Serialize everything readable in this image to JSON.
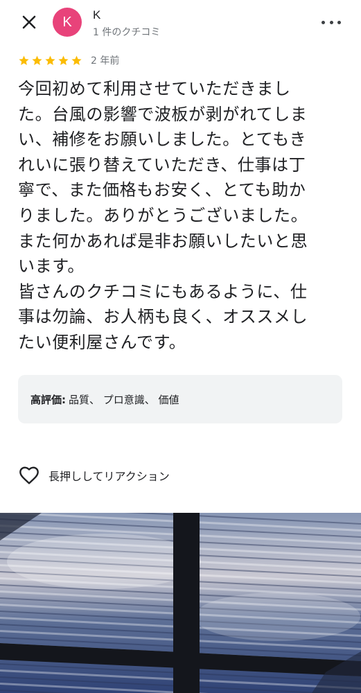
{
  "header": {
    "avatar_initial": "K",
    "author_name": "K",
    "author_meta": "1 件のクチコミ",
    "avatar_color": "#e8437a"
  },
  "rating": {
    "stars": 5,
    "max_stars": 5,
    "date": "2 年前",
    "star_color": "#fbbc04"
  },
  "review": {
    "lines": [
      "今回初めて利用させていただきまし",
      "た。台風の影響で波板が剥がれてしま",
      "い、補修をお願いしました。とてもき",
      "れいに張り替えていただき、仕事は丁",
      "寧で、また価格もお安く、とても助か",
      "りました。ありがとうございました。",
      "また何かあれば是非お願いしたいと思",
      "います。",
      "皆さんのクチコミにもあるように、仕",
      "事は勿論、お人柄も良く、オススメし",
      "たい便利屋さんです。"
    ]
  },
  "highlights": {
    "label": "高評価:",
    "items": "品質、 プロ意識、 価値"
  },
  "reaction": {
    "label": "長押ししてリアクション"
  },
  "photo": {
    "icon": "corrugated-roof-photo"
  }
}
